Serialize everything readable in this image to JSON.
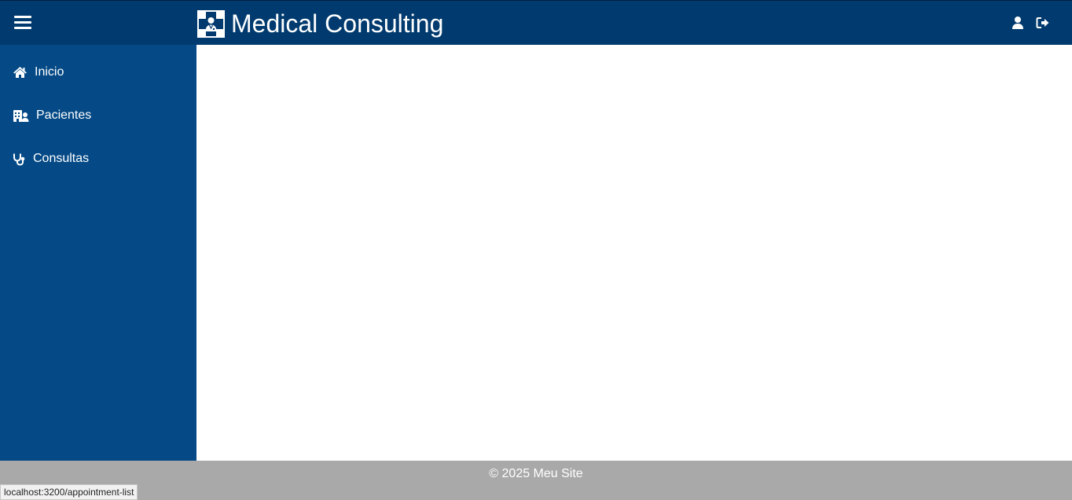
{
  "header": {
    "title": "Medical Consulting",
    "logo_icon": "medical-cross-doctor-icon",
    "menu_icon": "hamburger-menu-icon",
    "actions": [
      {
        "icon": "user-icon"
      },
      {
        "icon": "sign-out-icon"
      }
    ]
  },
  "sidebar": {
    "items": [
      {
        "label": "Inicio",
        "icon": "home-icon"
      },
      {
        "label": "Pacientes",
        "icon": "hospital-user-icon"
      },
      {
        "label": "Consultas",
        "icon": "stethoscope-icon"
      }
    ]
  },
  "footer": {
    "text": "© 2025 Meu Site"
  },
  "status_bar": {
    "url": "localhost:3200/appointment-list"
  },
  "colors": {
    "header_bg": "#003a6e",
    "sidebar_bg": "#054a86",
    "footer_bg": "#a9a9a9",
    "text_light": "#ffffff"
  }
}
